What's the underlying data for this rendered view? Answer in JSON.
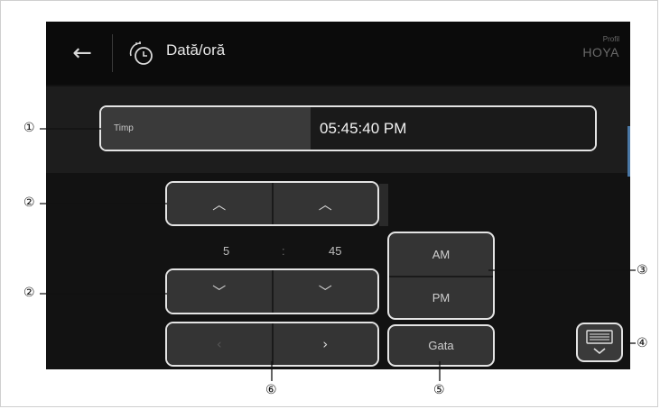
{
  "header": {
    "back_icon": "arrow-left-icon",
    "clock_icon": "clock-settings-icon",
    "title": "Dată/oră",
    "profile_label": "Profil",
    "profile_name": "HOYA"
  },
  "time_field": {
    "label": "Timp",
    "value": "05:45:40 PM"
  },
  "spinners": {
    "hour_value": "5",
    "separator": ":",
    "minute_value": "45",
    "up_symbol": "︿",
    "down_symbol": "﹀"
  },
  "ampm": {
    "am_label": "AM",
    "pm_label": "PM"
  },
  "nav": {
    "prev_symbol": "‹",
    "next_symbol": "›"
  },
  "done_label": "Gata",
  "keyboard_icon": "keyboard-icon",
  "callouts": {
    "c1": "①",
    "c2a": "②",
    "c2b": "②",
    "c3": "③",
    "c4": "④",
    "c5": "⑤",
    "c6": "⑥"
  },
  "colors": {
    "screen_bg": "#121212",
    "highlight_border": "#e4e4e4",
    "scroll_accent": "#4a78a6"
  }
}
